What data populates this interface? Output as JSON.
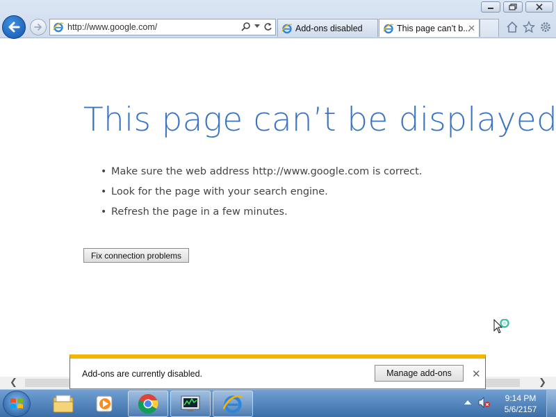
{
  "browser": {
    "address": {
      "url": "http://www.google.com/"
    },
    "tabs": [
      {
        "label": "Add-ons disabled",
        "active": false
      },
      {
        "label": "This page can’t b...",
        "active": true
      }
    ]
  },
  "page": {
    "headline": "This page can’t be displayed",
    "bullets": [
      "Make sure the web address http://www.google.com is correct.",
      "Look for the page with your search engine.",
      "Refresh the page in a few minutes."
    ],
    "fix_button": "Fix connection problems"
  },
  "notification": {
    "message": "Add-ons are currently disabled.",
    "manage_button": "Manage add-ons"
  },
  "taskbar": {
    "time": "9:14 PM",
    "date": "5/6/2157"
  },
  "colors": {
    "headline": "#3a74c4",
    "notification_accent": "#f2b600",
    "taskbar": "#3c6ea8"
  },
  "icons": [
    "back-arrow-icon",
    "forward-arrow-icon",
    "ie-icon",
    "search-icon",
    "refresh-icon",
    "home-icon",
    "favorites-star-icon",
    "gear-icon",
    "windows-logo-icon",
    "file-explorer-icon",
    "media-player-icon",
    "chrome-icon",
    "task-manager-icon",
    "volume-muted-icon"
  ]
}
